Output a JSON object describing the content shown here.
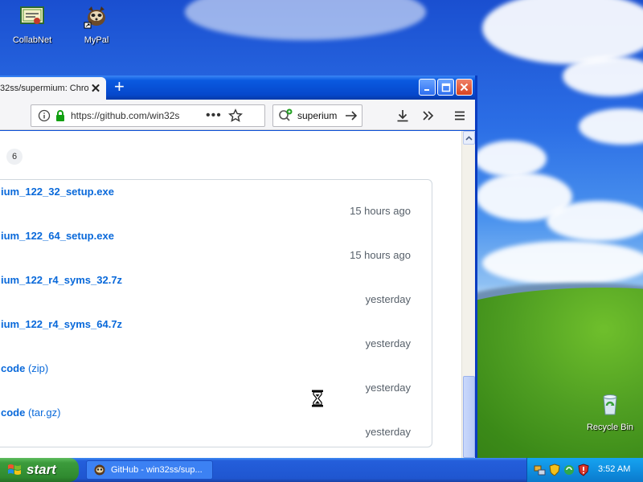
{
  "desktop": {
    "icons": [
      {
        "label": "CollabNet"
      },
      {
        "label": "MyPal"
      },
      {
        "label": "Recycle Bin"
      }
    ]
  },
  "browser": {
    "tab_title": "32ss/supermium: Chro",
    "url": "https://github.com/win32s",
    "search_value": "superium",
    "colors": {
      "link": "#0969da",
      "muted": "#57606a"
    }
  },
  "page": {
    "badge_count": "6",
    "assets": [
      {
        "name": "ium_122_32_setup.exe",
        "suffix": "",
        "time": "15 hours ago"
      },
      {
        "name": "ium_122_64_setup.exe",
        "suffix": "",
        "time": "15 hours ago"
      },
      {
        "name": "ium_122_r4_syms_32.7z",
        "suffix": "",
        "time": "yesterday"
      },
      {
        "name": "ium_122_r4_syms_64.7z",
        "suffix": "",
        "time": "yesterday"
      },
      {
        "name": "code",
        "suffix": " (zip)",
        "time": "yesterday"
      },
      {
        "name": "code",
        "suffix": " (tar.gz)",
        "time": "yesterday"
      }
    ]
  },
  "taskbar": {
    "start_label": "start",
    "task_label": "GitHub - win32ss/sup...",
    "clock": "3:52 AM"
  }
}
